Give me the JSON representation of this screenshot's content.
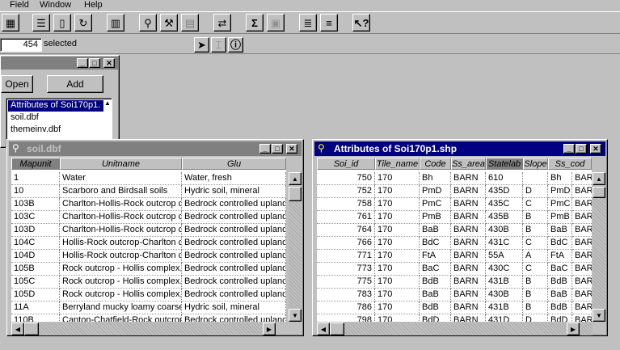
{
  "menu": {
    "items": [
      "Field",
      "Window",
      "Help"
    ]
  },
  "status": {
    "selected_count": "454",
    "selected_label": "selected"
  },
  "project": {
    "open_label": "Open",
    "add_label": "Add",
    "items": [
      "Attributes of Soi170p1.",
      "soil.dbf",
      "themeinv.dbf"
    ]
  },
  "soil": {
    "title": "soil.dbf",
    "columns": [
      "Mapunit",
      "Unitname",
      "Glu"
    ],
    "rows": [
      [
        "1",
        "Water",
        "Water, fresh"
      ],
      [
        "10",
        "Scarboro and Birdsall soils",
        "Hydric soil, mineral"
      ],
      [
        "103B",
        "Charlton-Hollis-Rock outcrop co",
        "Bedrock controlled upland"
      ],
      [
        "103C",
        "Charlton-Hollis-Rock outcrop co",
        "Bedrock controlled upland"
      ],
      [
        "103D",
        "Charlton-Hollis-Rock outcrop co",
        "Bedrock controlled upland"
      ],
      [
        "104C",
        "Hollis-Rock outcrop-Charlton co",
        "Bedrock controlled upland"
      ],
      [
        "104D",
        "Hollis-Rock outcrop-Charlton co",
        "Bedrock controlled upland"
      ],
      [
        "105B",
        "Rock outcrop - Hollis complex,",
        "Bedrock controlled upland"
      ],
      [
        "105C",
        "Rock outcrop - Hollis complex,",
        "Bedrock controlled upland"
      ],
      [
        "105D",
        "Rock outcrop - Hollis complex,",
        "Bedrock controlled upland"
      ],
      [
        "11A",
        "Berryland mucky loamy coarse",
        "Hydric soil, mineral"
      ],
      [
        "110B",
        "Canton-Chatfield-Rock outcrop",
        "Bedrock controlled upland"
      ]
    ]
  },
  "attrs": {
    "title": "Attributes of Soi170p1.shp",
    "columns": [
      "Soi_id",
      "Tile_name",
      "Code",
      "Ss_area",
      "Statelab",
      "Slope",
      "Ss_cod"
    ],
    "rows": [
      [
        "750",
        "170",
        "Bh",
        "BARN",
        "610",
        "",
        "Bh",
        "BARN"
      ],
      [
        "752",
        "170",
        "PmD",
        "BARN",
        "435D",
        "D",
        "PmD",
        "BARN"
      ],
      [
        "758",
        "170",
        "PmC",
        "BARN",
        "435C",
        "C",
        "PmC",
        "BARN"
      ],
      [
        "761",
        "170",
        "PmB",
        "BARN",
        "435B",
        "B",
        "PmB",
        "BARN"
      ],
      [
        "764",
        "170",
        "BaB",
        "BARN",
        "430B",
        "B",
        "BaB",
        "BARN"
      ],
      [
        "766",
        "170",
        "BdC",
        "BARN",
        "431C",
        "C",
        "BdC",
        "BARN"
      ],
      [
        "771",
        "170",
        "FtA",
        "BARN",
        "55A",
        "A",
        "FtA",
        "BARN"
      ],
      [
        "773",
        "170",
        "BaC",
        "BARN",
        "430C",
        "C",
        "BaC",
        "BARN"
      ],
      [
        "775",
        "170",
        "BdB",
        "BARN",
        "431B",
        "B",
        "BdB",
        "BARN"
      ],
      [
        "783",
        "170",
        "BaB",
        "BARN",
        "430B",
        "B",
        "BaB",
        "BARN"
      ],
      [
        "786",
        "170",
        "BdB",
        "BARN",
        "431B",
        "B",
        "BdB",
        "BARN"
      ],
      [
        "798",
        "170",
        "BdD",
        "BARN",
        "431D",
        "D",
        "BdD",
        "BARN"
      ]
    ]
  },
  "colors": {
    "title_active": "#000080",
    "title_inactive": "#808080",
    "face": "#c0c0c0"
  }
}
